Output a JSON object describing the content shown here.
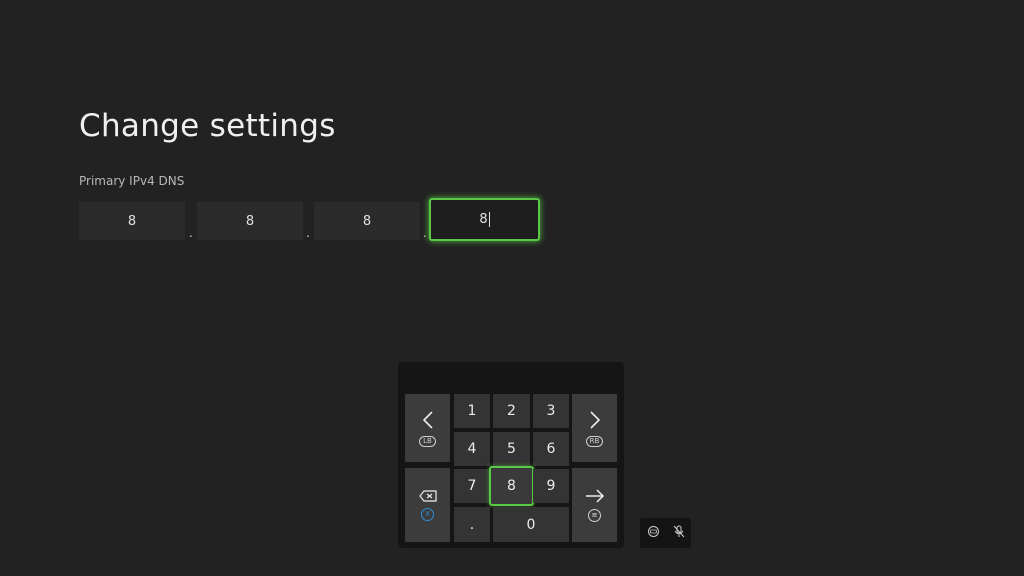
{
  "page": {
    "title": "Change settings"
  },
  "dns": {
    "label": "Primary IPv4 DNS",
    "octets": [
      "8",
      "8",
      "8",
      "8"
    ],
    "separator": "."
  },
  "keypad": {
    "keys": [
      "1",
      "2",
      "3",
      "4",
      "5",
      "6",
      "7",
      "8",
      "9",
      ".",
      "0"
    ],
    "focused_key": "8",
    "left_hint": "LB",
    "right_hint": "RB",
    "backspace_hint": "X",
    "enter_hint": "≡"
  },
  "icons": {
    "left": "chevron-left-icon",
    "right": "chevron-right-icon",
    "backspace": "backspace-icon",
    "enter": "arrow-right-icon",
    "toolbar": [
      "controller-icon",
      "mic-off-icon"
    ]
  },
  "colors": {
    "focus": "#5ac846",
    "background": "#222222",
    "key": "#343434"
  }
}
